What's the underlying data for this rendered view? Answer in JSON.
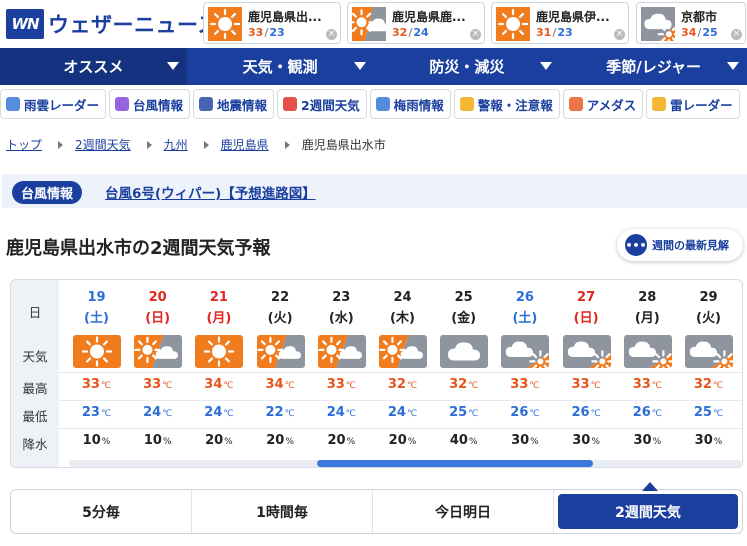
{
  "logo": {
    "mark": "WN",
    "text": "ウェザーニュース"
  },
  "favorites": [
    {
      "name": "鹿児島県出...",
      "hi": "33",
      "lo": "23",
      "icon": "sun-icon"
    },
    {
      "name": "鹿児島県鹿...",
      "hi": "32",
      "lo": "24",
      "icon": "sun-cloud-icon"
    },
    {
      "name": "鹿児島県伊...",
      "hi": "31",
      "lo": "23",
      "icon": "sun-icon"
    },
    {
      "name": "京都市",
      "hi": "34",
      "lo": "25",
      "icon": "cloud-sun-icon"
    }
  ],
  "nav": [
    {
      "label": "オススメ",
      "active": true
    },
    {
      "label": "天気・観測"
    },
    {
      "label": "防災・減災"
    },
    {
      "label": "季節/レジャー"
    }
  ],
  "subnav": [
    {
      "label": "雨雲レーダー",
      "icon": "radar-icon",
      "color": "#2b6fd6"
    },
    {
      "label": "台風情報",
      "icon": "typhoon-icon",
      "color": "#7c3fd6"
    },
    {
      "label": "地震情報",
      "icon": "house-icon",
      "color": "#1a3f9e"
    },
    {
      "label": "2週間天気",
      "icon": "calendar-icon",
      "color": "#e0261d"
    },
    {
      "label": "梅雨情報",
      "icon": "rain-icon",
      "color": "#2b6fd6"
    },
    {
      "label": "警報・注意報",
      "icon": "warning-icon",
      "color": "#f0a500"
    },
    {
      "label": "アメダス",
      "icon": "chart-icon",
      "color": "#e8541c"
    },
    {
      "label": "雷レーダー",
      "icon": "lightning-icon",
      "color": "#f0a500"
    }
  ],
  "breadcrumb": [
    {
      "label": "トップ",
      "link": true
    },
    {
      "label": "2週間天気",
      "link": true
    },
    {
      "label": "九州",
      "link": true
    },
    {
      "label": "鹿児島県",
      "link": true
    },
    {
      "label": "鹿児島県出水市",
      "link": false
    }
  ],
  "typhoon": {
    "badge": "台風情報",
    "link": "台風6号(ウィパー)【予想進路図】"
  },
  "page_title": "鹿児島県出水市の2週間天気予報",
  "latest_button": "週間の最新見解",
  "row_labels": {
    "day": "日",
    "weather": "天気",
    "high": "最高",
    "low": "最低",
    "precip": "降水"
  },
  "units": {
    "temp": "℃",
    "precip": "%"
  },
  "days": [
    {
      "date": "19",
      "dow": "(土)",
      "type": "sat",
      "icon": "sun",
      "hi": "33",
      "lo": "23",
      "pr": "10"
    },
    {
      "date": "20",
      "dow": "(日)",
      "type": "sun",
      "icon": "sun-cloud",
      "hi": "33",
      "lo": "24",
      "pr": "10"
    },
    {
      "date": "21",
      "dow": "(月)",
      "type": "sun",
      "icon": "sun",
      "hi": "34",
      "lo": "24",
      "pr": "20"
    },
    {
      "date": "22",
      "dow": "(火)",
      "type": "wd",
      "icon": "sun-cloud",
      "hi": "34",
      "lo": "22",
      "pr": "20"
    },
    {
      "date": "23",
      "dow": "(水)",
      "type": "wd",
      "icon": "sun-cloud",
      "hi": "33",
      "lo": "24",
      "pr": "20"
    },
    {
      "date": "24",
      "dow": "(木)",
      "type": "wd",
      "icon": "sun-cloud",
      "hi": "32",
      "lo": "24",
      "pr": "20"
    },
    {
      "date": "25",
      "dow": "(金)",
      "type": "wd",
      "icon": "cloud",
      "hi": "32",
      "lo": "25",
      "pr": "40"
    },
    {
      "date": "26",
      "dow": "(土)",
      "type": "sat",
      "icon": "cloud-sun",
      "hi": "33",
      "lo": "26",
      "pr": "30"
    },
    {
      "date": "27",
      "dow": "(日)",
      "type": "sun",
      "icon": "cloud-sun",
      "hi": "33",
      "lo": "26",
      "pr": "30"
    },
    {
      "date": "28",
      "dow": "(月)",
      "type": "wd",
      "icon": "cloud-sun",
      "hi": "33",
      "lo": "26",
      "pr": "30"
    },
    {
      "date": "29",
      "dow": "(火)",
      "type": "wd",
      "icon": "cloud-sun",
      "hi": "32",
      "lo": "25",
      "pr": "30"
    }
  ],
  "tabs": [
    {
      "label": "5分毎"
    },
    {
      "label": "1時間毎"
    },
    {
      "label": "今日明日"
    },
    {
      "label": "2週間天気",
      "active": true
    }
  ],
  "colors": {
    "brand": "#1a3f9e",
    "hi": "#e8541c",
    "lo": "#2b6fd6",
    "sunday": "#e0261d",
    "sun_bg": "#f07c1e",
    "cloud_bg": "#8e959e"
  }
}
